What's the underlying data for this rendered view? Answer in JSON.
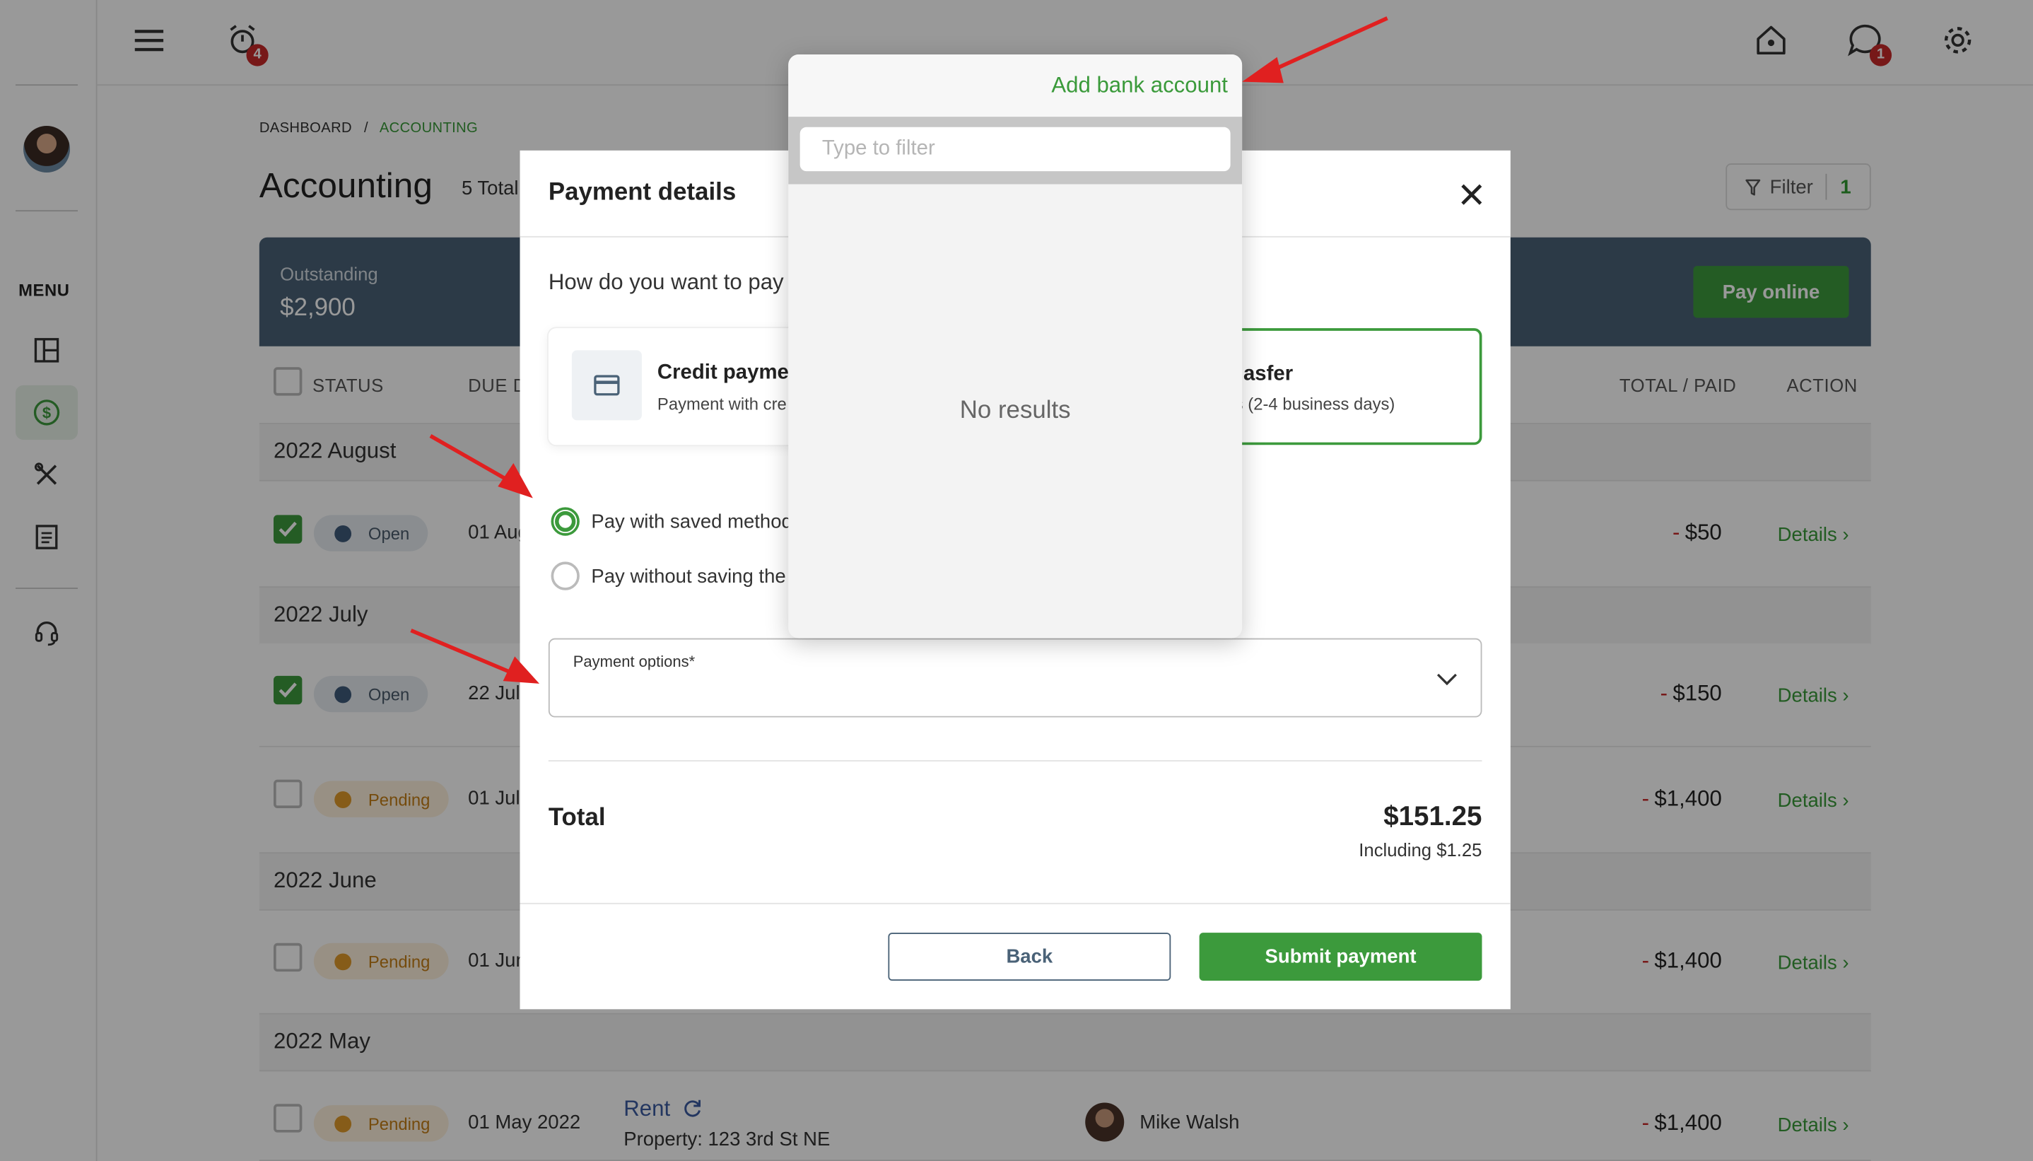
{
  "topbar": {
    "notifications_count": "4",
    "messages_count": "1"
  },
  "sidebar": {
    "menu_label": "MENU"
  },
  "breadcrumb": {
    "home": "DASHBOARD",
    "separator": "/",
    "current": "ACCOUNTING"
  },
  "page": {
    "title": "Accounting",
    "total": "5 Total",
    "filter_label": "Filter",
    "filter_count": "1"
  },
  "summary": {
    "label": "Outstanding",
    "amount": "$2,900",
    "pay_button": "Pay online"
  },
  "table": {
    "headers": [
      "STATUS",
      "DUE D",
      "TOTAL / PAID",
      "ACTION"
    ],
    "groups": [
      "2022 August",
      "2022 July",
      "2022 June",
      "2022 May"
    ],
    "rows": [
      {
        "status": "Open",
        "due": "01 Aug",
        "amount": "$50",
        "action": "Details"
      },
      {
        "status": "Open",
        "due": "22 Jul",
        "amount": "$150",
        "action": "Details"
      },
      {
        "status": "Pending",
        "due": "01 Jul",
        "amount": "$1,400",
        "action": "Details"
      },
      {
        "status": "Pending",
        "due": "01 Jun",
        "amount": "$1,400",
        "action": "Details"
      },
      {
        "status": "Pending",
        "due": "01 May 2022",
        "title": "Rent",
        "property": "Property: 123 3rd St NE",
        "person": "Mike Walsh",
        "amount": "$1,400",
        "action": "Details"
      }
    ],
    "neg_sign": "-",
    "details_chevron": "›"
  },
  "modal": {
    "title": "Payment details",
    "question": "How do you want to pay",
    "credit": {
      "title": "Credit payme",
      "subtitle": "Payment with cre"
    },
    "bank": {
      "title": "asfer",
      "subtitle": "rs (2-4 business days)"
    },
    "radio_saved": "Pay with saved method",
    "radio_unsaved": "Pay without saving the",
    "select_label": "Payment options*",
    "total_label": "Total",
    "total_amount": "$151.25",
    "total_including": "Including $1.25",
    "back_button": "Back",
    "submit_button": "Submit payment"
  },
  "dropdown": {
    "add_label": "Add bank account",
    "filter_placeholder": "Type to filter",
    "empty_text": "No results"
  },
  "colors": {
    "accent_green": "#3c9a3c",
    "summary_bg": "#4a6277",
    "danger": "#c62828",
    "pending": "#c47e17"
  }
}
